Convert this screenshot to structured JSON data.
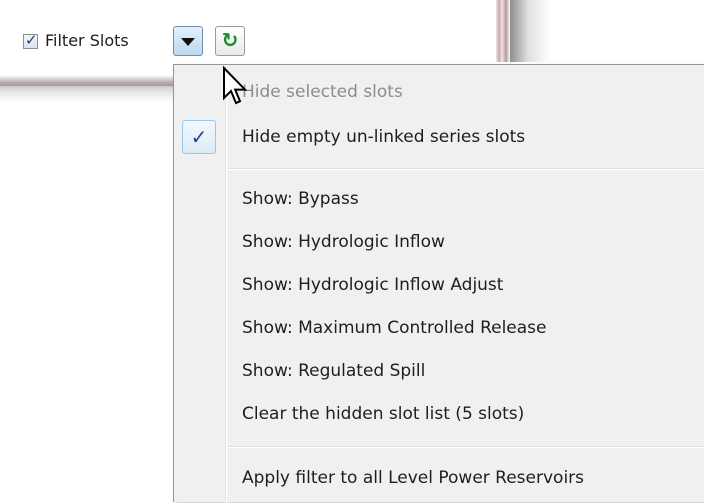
{
  "toolbar": {
    "filter_checkbox_checked": true,
    "filter_label": "Filter Slots",
    "dropdown_icon": "chevron-down-icon",
    "refresh_icon": "refresh-icon",
    "refresh_color": "#1b8a2a"
  },
  "menu": {
    "items": [
      {
        "label": "Hide selected slots",
        "enabled": false,
        "checked": false
      },
      {
        "label": "Hide empty un-linked series slots",
        "enabled": true,
        "checked": true
      },
      {
        "label": "Show: Bypass",
        "enabled": true,
        "checked": false
      },
      {
        "label": "Show: Hydrologic Inflow",
        "enabled": true,
        "checked": false
      },
      {
        "label": "Show: Hydrologic Inflow Adjust",
        "enabled": true,
        "checked": false
      },
      {
        "label": "Show: Maximum Controlled Release",
        "enabled": true,
        "checked": false
      },
      {
        "label": "Show: Regulated Spill",
        "enabled": true,
        "checked": false
      },
      {
        "label": "Clear the hidden slot list (5 slots)",
        "enabled": true,
        "checked": false
      },
      {
        "label": "Apply filter to all Level Power Reservoirs",
        "enabled": true,
        "checked": false
      }
    ],
    "checkmark_glyph": "✓"
  }
}
